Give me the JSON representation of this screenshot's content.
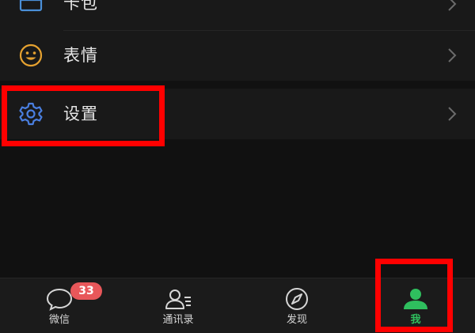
{
  "menu": {
    "items": [
      {
        "label": "卡包",
        "icon": "card-wallet-icon"
      },
      {
        "label": "表情",
        "icon": "sticker-smiley-icon"
      },
      {
        "label": "设置",
        "icon": "settings-gear-icon"
      }
    ]
  },
  "tabbar": {
    "tabs": [
      {
        "label": "微信",
        "icon": "chat-bubble-icon",
        "badge": "33"
      },
      {
        "label": "通讯录",
        "icon": "contacts-icon"
      },
      {
        "label": "发现",
        "icon": "compass-icon"
      },
      {
        "label": "我",
        "icon": "person-icon",
        "active": true
      }
    ]
  },
  "colors": {
    "background": "#111111",
    "row_background": "#191919",
    "highlight": "#ff0000",
    "active_tab": "#2fbf5e",
    "badge": "#e8575a",
    "settings_icon": "#4a7fe0",
    "sticker_icon": "#e6a230",
    "card_icon": "#4a8fd8"
  }
}
